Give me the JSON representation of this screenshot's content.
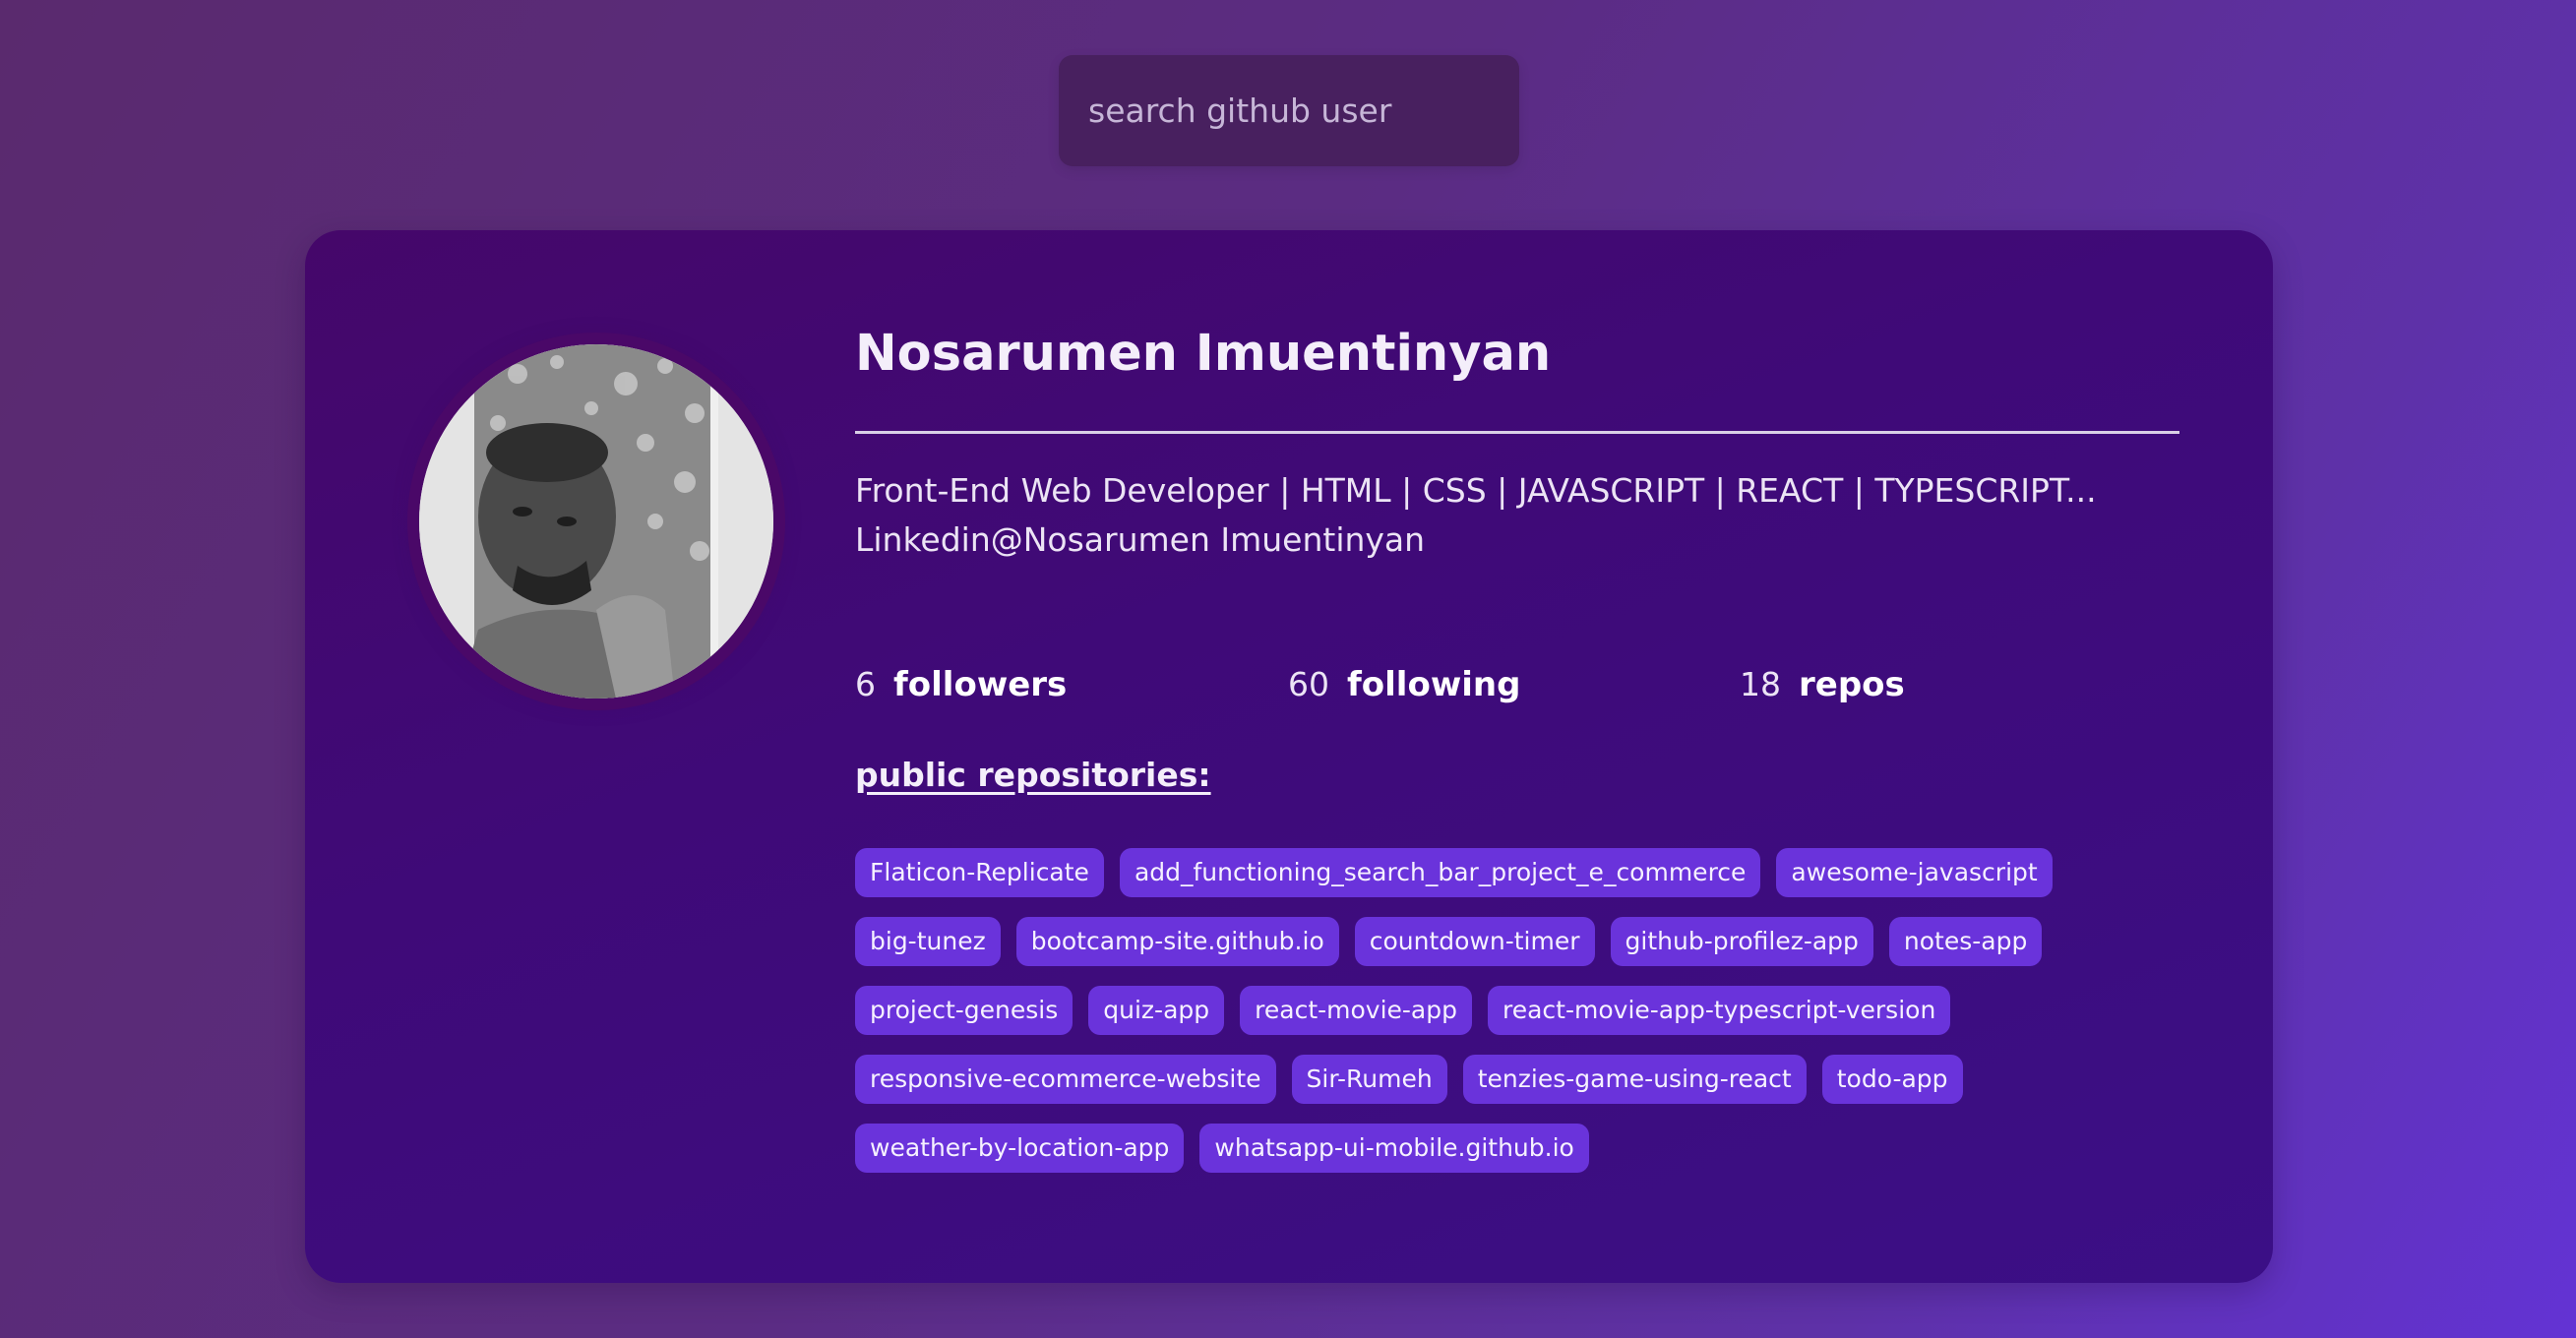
{
  "search": {
    "placeholder": "search github user",
    "value": ""
  },
  "profile": {
    "name": "Nosarumen Imuentinyan",
    "bio_line1": "Front-End Web Developer | HTML | CSS | JAVASCRIPT | REACT | TYPESCRIPT...",
    "bio_line2": "Linkedin@Nosarumen Imuentinyan",
    "avatar_alt": "avatar",
    "stats": {
      "followers_count": "6",
      "followers_label": "followers",
      "following_count": "60",
      "following_label": "following",
      "repos_count": "18",
      "repos_label": "repos"
    }
  },
  "repositories": {
    "heading": "public repositories:",
    "items": [
      "Flaticon-Replicate",
      "add_functioning_search_bar_project_e_commerce",
      "awesome-javascript",
      "big-tunez",
      "bootcamp-site.github.io",
      "countdown-timer",
      "github-profilez-app",
      "notes-app",
      "project-genesis",
      "quiz-app",
      "react-movie-app",
      "react-movie-app-typescript-version",
      "responsive-ecommerce-website",
      "Sir-Rumeh",
      "tenzies-game-using-react",
      "todo-app",
      "weather-by-location-app",
      "whatsapp-ui-mobile.github.io"
    ]
  },
  "colors": {
    "background": "#5b2c83",
    "card": "#3f0a78",
    "tag": "#6a33db",
    "search_box": "#48205f"
  }
}
